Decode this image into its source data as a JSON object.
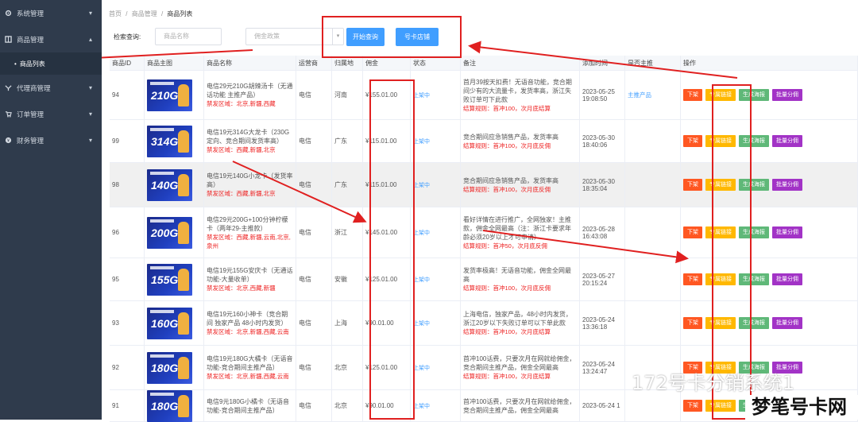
{
  "sidebar": {
    "items": [
      {
        "label": "系统管理",
        "icon": "gear-icon"
      },
      {
        "label": "商品管理",
        "icon": "grid-icon"
      },
      {
        "label": "代理商管理",
        "icon": "share-icon"
      },
      {
        "label": "订单管理",
        "icon": "cart-icon"
      },
      {
        "label": "财务管理",
        "icon": "wallet-icon"
      }
    ],
    "sub_item": "商品列表"
  },
  "breadcrumb": {
    "home": "首页",
    "sep": "/",
    "mid": "商品管理",
    "current": "商品列表"
  },
  "search": {
    "label": "检索查询:",
    "name_placeholder": "商品名称",
    "policy_placeholder": "佣金政策",
    "search_btn": "开始查询",
    "shop_btn": "号卡店铺"
  },
  "table": {
    "headers": [
      "商品ID",
      "商品主图",
      "商品名称",
      "运营商",
      "归属地",
      "佣金",
      "状态",
      "备注",
      "添加时间",
      "是否主推",
      "操作"
    ],
    "actions": {
      "down": "下架",
      "link": "专属链接",
      "poster": "生成海报",
      "batch": "批量分佣"
    },
    "rows": [
      {
        "id": "94",
        "gb": "210G",
        "name": "电信29元210G胡辣汤卡（无通话功能 主推产品）",
        "ban": "禁发区域：北京,新疆,西藏",
        "op": "电信",
        "loc": "河南",
        "com": "¥155.01.00",
        "status": "上架中",
        "note": "首月39按天扣费！无语音功能，竞合期间少有的大流量卡，发货率高，浙江失败订单可下此款",
        "rule": "结算规则：首冲100，次月底结算",
        "time": "2023-05-25 19:08:50",
        "main": "主推产品"
      },
      {
        "id": "99",
        "gb": "314G",
        "name": "电信19元314G大龙卡（230G定向、竞合期间发货率高）",
        "ban": "禁发区域：西藏,新疆,北京",
        "op": "电信",
        "loc": "广东",
        "com": "¥115.01.00",
        "status": "上架中",
        "note": "竞合期间应急销售产品，发货率高",
        "rule": "结算规则：首冲100，次月底反佣",
        "time": "2023-05-30 18:40:06",
        "main": ""
      },
      {
        "id": "98",
        "gb": "140G",
        "name": "电信19元140G小龙卡（发货率高）",
        "ban": "禁发区域：西藏,新疆,北京",
        "op": "电信",
        "loc": "广东",
        "com": "¥115.01.00",
        "status": "上架中",
        "note": "竞合期间应急销售产品，发货率高",
        "rule": "结算规则：首冲100，次月底反佣",
        "time": "2023-05-30 18:35:04",
        "main": ""
      },
      {
        "id": "96",
        "gb": "200G",
        "name": "电信29元200G+100分钟柠檬卡（两年29-主推款）",
        "ban": "禁发区域：西藏,新疆,云南,北京,泉州",
        "op": "电信",
        "loc": "浙江",
        "com": "¥145.01.00",
        "status": "上架中",
        "note": "看好详情在进行推广，全网独家！主推款，佣金全网最高（注：浙江卡要求年龄必须20岁以上才可申请）",
        "rule": "结算规则：首冲50，次月底反佣",
        "time": "2023-05-28 16:43:08",
        "main": ""
      },
      {
        "id": "95",
        "gb": "155G",
        "name": "电信19元155G安庆卡（无通话功能-大量收单）",
        "ban": "禁发区域：北京,西藏,新疆",
        "op": "电信",
        "loc": "安徽",
        "com": "¥125.01.00",
        "status": "上架中",
        "note": "发货率极高！无语音功能，佣金全网最高",
        "rule": "结算规则：首冲100，次月底反佣",
        "time": "2023-05-27 20:15:24",
        "main": ""
      },
      {
        "id": "93",
        "gb": "160G",
        "name": "电信19元160小神卡（竞合期间 独家产品 48小时内发货）",
        "ban": "禁发区域：北京,新疆,西藏,云南",
        "op": "电信",
        "loc": "上海",
        "com": "¥90.01.00",
        "status": "上架中",
        "note": "上海电信，独家产品，48小时内发货，浙江20岁以下失败订单可以下单此款",
        "rule": "结算规则：首冲100，次月底结算",
        "time": "2023-05-24 13:36:18",
        "main": ""
      },
      {
        "id": "92",
        "gb": "180G",
        "name": "电信19元180G大橘卡（无语音功能-竞合期间主推产品）",
        "ban": "禁发区域：北京,新疆,西藏,云南",
        "op": "电信",
        "loc": "北京",
        "com": "¥125.01.00",
        "status": "上架中",
        "note": "首冲100话费，只要次月在网就给佣金，竞合期间主推产品，佣金全网最高",
        "rule": "结算规则：首冲100，次月底结算",
        "time": "2023-05-24 13:24:47",
        "main": ""
      },
      {
        "id": "91",
        "gb": "180G",
        "name": "电信9元180G小橘卡（无语音功能-竞合期间主推产品）",
        "ban": "",
        "op": "电信",
        "loc": "北京",
        "com": "¥90.01.00",
        "status": "上架中",
        "note": "首冲100话费，只要次月在网就给佣金，竞合期间主推产品，佣金全网最高",
        "rule": "",
        "time": "2023-05-24 1",
        "main": ""
      }
    ]
  },
  "watermark": "172号卡分销系统1",
  "brand": "梦笔号卡网",
  "colors": {
    "sidebar": "#2f3b4c",
    "primary": "#409eff",
    "annotation": "#e02020"
  }
}
